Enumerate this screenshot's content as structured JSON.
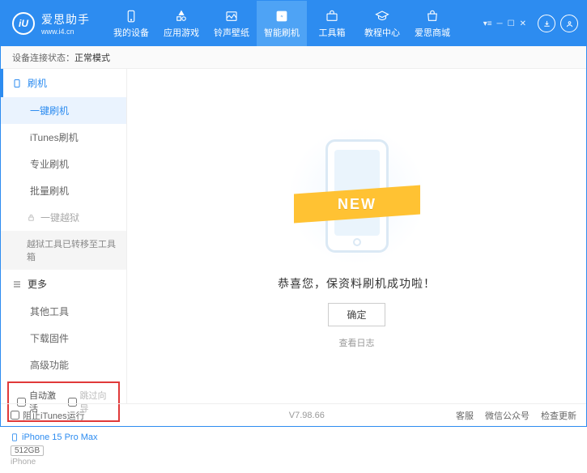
{
  "app": {
    "name": "爱思助手",
    "url": "www.i4.cn",
    "logo_text": "iU"
  },
  "nav": [
    {
      "label": "我的设备"
    },
    {
      "label": "应用游戏"
    },
    {
      "label": "铃声壁纸"
    },
    {
      "label": "智能刷机"
    },
    {
      "label": "工具箱"
    },
    {
      "label": "教程中心"
    },
    {
      "label": "爱思商城"
    }
  ],
  "status": {
    "label": "设备连接状态：",
    "value": "正常模式"
  },
  "sidebar": {
    "flash": {
      "head": "刷机",
      "items": [
        "一键刷机",
        "iTunes刷机",
        "专业刷机",
        "批量刷机"
      ]
    },
    "jailbreak": {
      "head": "一键越狱",
      "note": "越狱工具已转移至工具箱"
    },
    "more": {
      "head": "更多",
      "items": [
        "其他工具",
        "下载固件",
        "高级功能"
      ]
    },
    "auto_activate": "自动激活",
    "skip_guide": "跳过向导"
  },
  "device": {
    "name": "iPhone 15 Pro Max",
    "capacity": "512GB",
    "type": "iPhone"
  },
  "main": {
    "ribbon": "NEW",
    "message": "恭喜您，保资料刷机成功啦！",
    "ok": "确定",
    "loglink": "查看日志"
  },
  "footer": {
    "block_itunes": "阻止iTunes运行",
    "version": "V7.98.66",
    "links": [
      "客服",
      "微信公众号",
      "检查更新"
    ]
  }
}
